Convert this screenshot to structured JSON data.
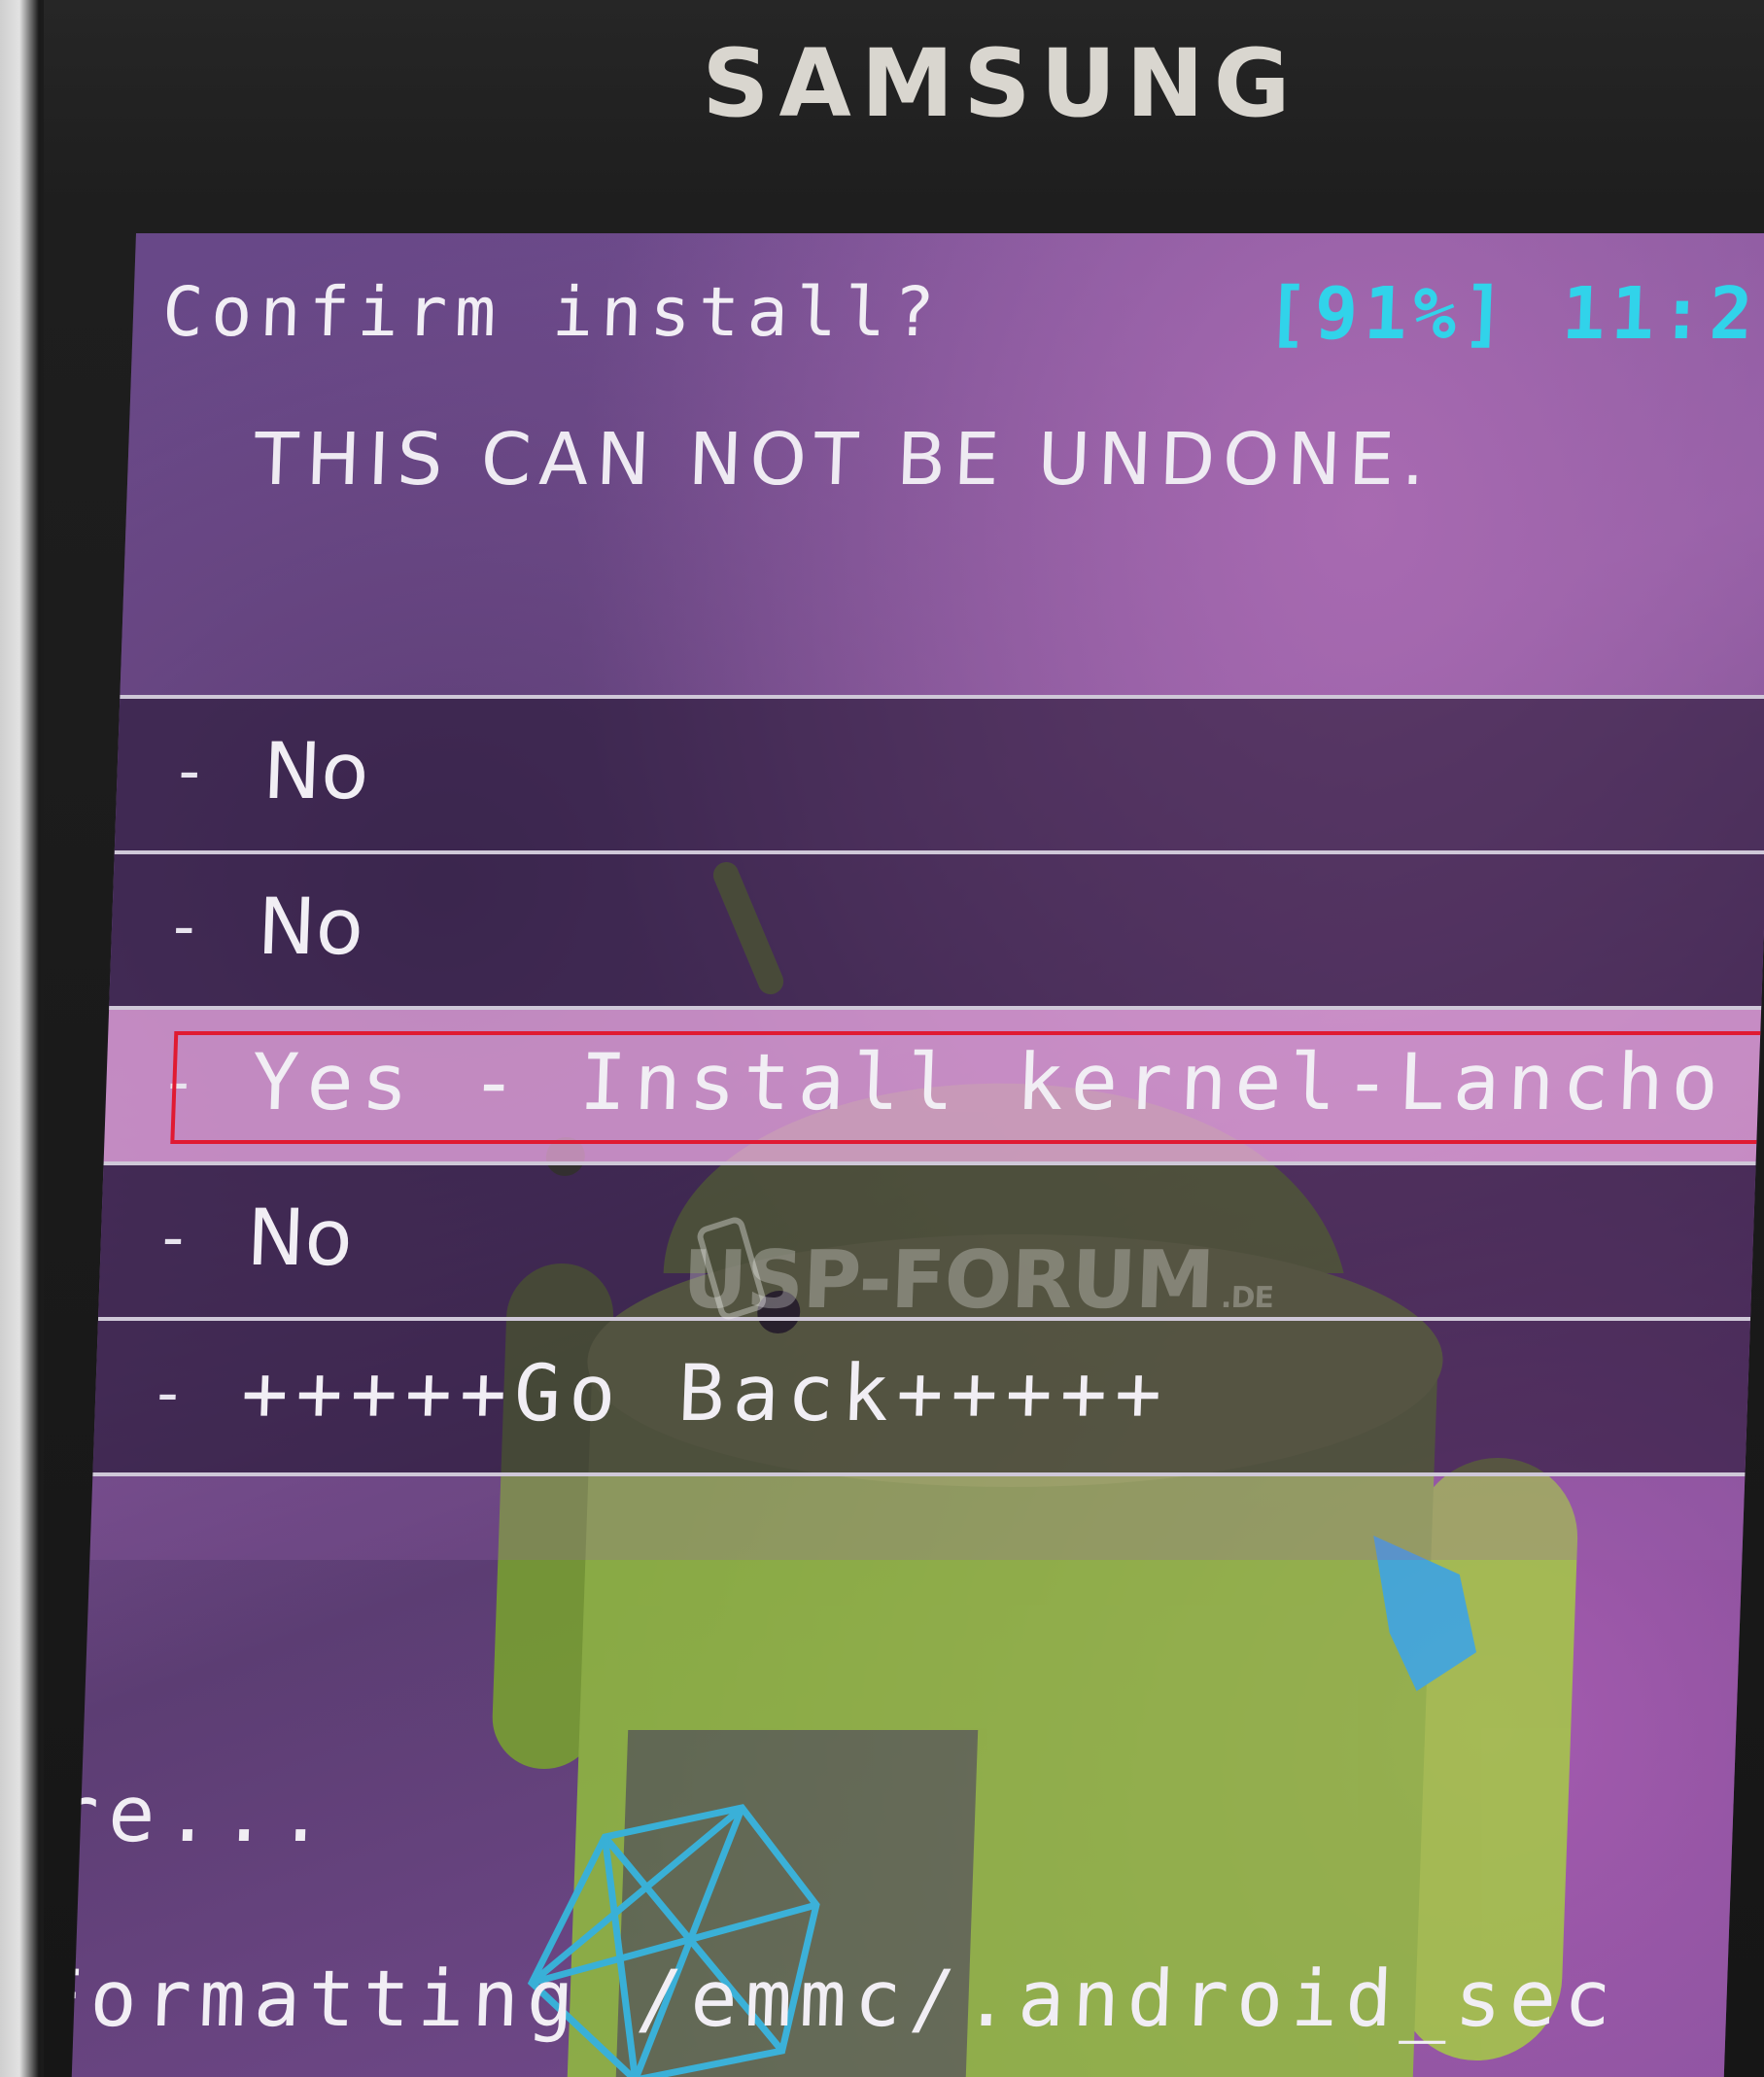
{
  "device": {
    "brand": "SAMSUNG"
  },
  "recovery": {
    "header_title": "Confirm install?",
    "battery": "[91%]",
    "clock": "11:2",
    "warning": "THIS CAN NOT BE UNDONE.",
    "menu": {
      "items": [
        {
          "dash": "-",
          "label": "No"
        },
        {
          "dash": "-",
          "label": "No"
        },
        {
          "dash": "-",
          "label": "Yes - Install kernel-Lancho"
        },
        {
          "dash": "-",
          "label": "No"
        },
        {
          "dash": "-",
          "label": "+++++Go Back+++++"
        }
      ],
      "selected_index": 2
    },
    "log_lines": [
      "re...",
      "Formatting /emmc/.android_sec"
    ]
  },
  "watermark": {
    "text": "USP-FORUM",
    "suffix": ".DE"
  },
  "colors": {
    "accent_status": "#31d3ea",
    "selection_outline": "#e01a32",
    "highlight_row": "#d296cd",
    "android_green": "#9bc53d"
  },
  "icons": {
    "android_robot": "android-robot-icon",
    "watermark_phone": "phone-icon"
  }
}
